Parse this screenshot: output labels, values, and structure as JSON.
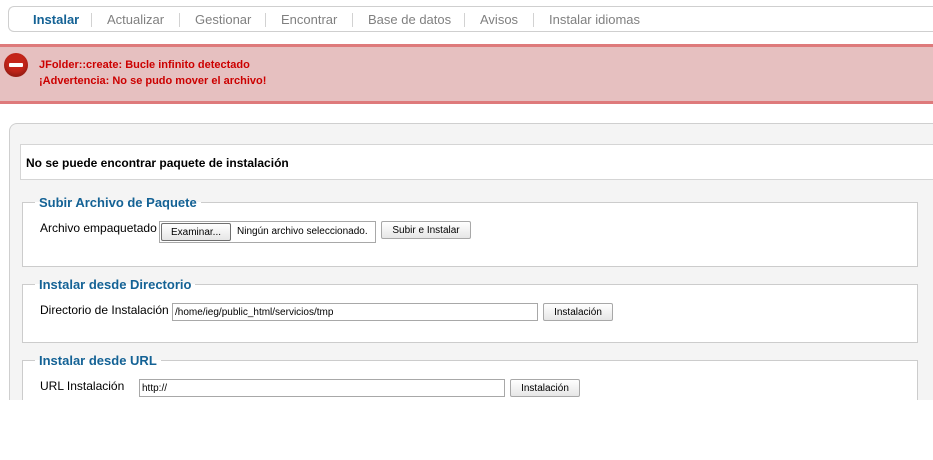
{
  "tabs": [
    {
      "label": "Instalar",
      "active": true
    },
    {
      "label": "Actualizar",
      "active": false
    },
    {
      "label": "Gestionar",
      "active": false
    },
    {
      "label": "Encontrar",
      "active": false
    },
    {
      "label": "Base de datos",
      "active": false
    },
    {
      "label": "Avisos",
      "active": false
    },
    {
      "label": "Instalar idiomas",
      "active": false
    }
  ],
  "alert": {
    "icon": "error-stop-icon",
    "messages": [
      "JFolder::create: Bucle infinito detectado",
      "¡Advertencia: No se pudo mover el archivo!"
    ]
  },
  "notice": "No se puede encontrar paquete de instalación",
  "upload": {
    "legend": "Subir Archivo de Paquete",
    "label": "Archivo empaquetado",
    "browse_label": "Examinar...",
    "no_file": "Ningún archivo seleccionado.",
    "submit_label": "Subir e Instalar"
  },
  "directory": {
    "legend": "Instalar desde Directorio",
    "label": "Directorio de Instalación",
    "value": "/home/ieg/public_html/servicios/tmp",
    "submit_label": "Instalación"
  },
  "url": {
    "legend": "Instalar desde URL",
    "label": "URL Instalación",
    "value": "http://",
    "submit_label": "Instalación"
  },
  "colors": {
    "accent": "#146295",
    "error_text": "#cc0000",
    "banner_bg": "#e6c0c0",
    "banner_border": "#de7a7b"
  }
}
